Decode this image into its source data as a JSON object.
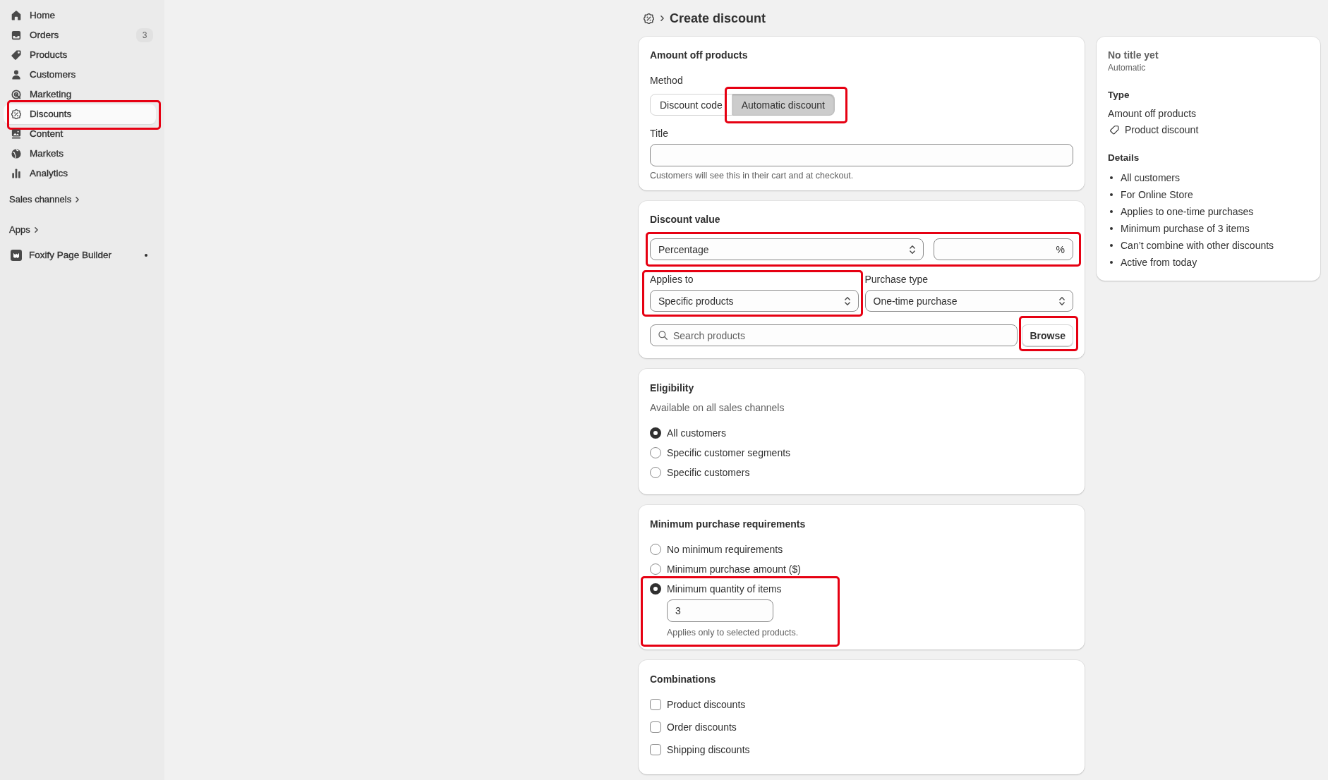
{
  "sidebar": {
    "items": [
      {
        "label": "Home",
        "selected": false,
        "highlighted": false
      },
      {
        "label": "Orders",
        "badge": "3",
        "selected": false,
        "highlighted": false
      },
      {
        "label": "Products",
        "selected": false,
        "highlighted": false
      },
      {
        "label": "Customers",
        "selected": false,
        "highlighted": false
      },
      {
        "label": "Marketing",
        "selected": false,
        "highlighted": false
      },
      {
        "label": "Discounts",
        "selected": true,
        "highlighted": true
      },
      {
        "label": "Content",
        "selected": false,
        "highlighted": false
      },
      {
        "label": "Markets",
        "selected": false,
        "highlighted": false
      },
      {
        "label": "Analytics",
        "selected": false,
        "highlighted": false
      }
    ],
    "sections": [
      {
        "label": "Sales channels"
      },
      {
        "label": "Apps",
        "apps": [
          {
            "label": "Foxify Page Builder"
          }
        ]
      }
    ]
  },
  "header": {
    "title": "Create discount"
  },
  "method_card": {
    "title": "Amount off products",
    "method": {
      "label": "Method",
      "options": [
        {
          "label": "Discount code",
          "selected": false,
          "highlighted": false
        },
        {
          "label": "Automatic discount",
          "selected": true,
          "highlighted": true
        }
      ]
    },
    "title_field": {
      "label": "Title",
      "help": "Customers will see this in their cart and at checkout."
    }
  },
  "value_card": {
    "title": "Discount value",
    "discount": {
      "type": "Percentage",
      "suffix": "%",
      "highlighted": true
    },
    "applies_to": {
      "label": "Applies to",
      "value": "Specific products",
      "highlighted": true
    },
    "purchase_type": {
      "label": "Purchase type",
      "value": "One-time purchase"
    },
    "search": {
      "placeholder": "Search products"
    },
    "browse_button": {
      "label": "Browse",
      "highlighted": true
    }
  },
  "eligibility_card": {
    "title": "Eligibility",
    "subtitle": "Available on all sales channels",
    "options": [
      {
        "label": "All customers",
        "selected": true
      },
      {
        "label": "Specific customer segments",
        "selected": false
      },
      {
        "label": "Specific customers",
        "selected": false
      }
    ]
  },
  "minimum_card": {
    "title": "Minimum purchase requirements",
    "options": [
      {
        "label": "No minimum requirements",
        "selected": false,
        "highlighted": false
      },
      {
        "label": "Minimum purchase amount ($)",
        "selected": false,
        "highlighted": false
      },
      {
        "label": "Minimum quantity of items",
        "selected": true,
        "highlighted": true,
        "value": "3",
        "help": "Applies only to selected products."
      }
    ]
  },
  "combinations_card": {
    "title": "Combinations",
    "options": [
      {
        "label": "Product discounts",
        "checked": false
      },
      {
        "label": "Order discounts",
        "checked": false
      },
      {
        "label": "Shipping discounts",
        "checked": false
      }
    ]
  },
  "summary": {
    "title": "No title yet",
    "method": "Automatic",
    "type": {
      "heading": "Type",
      "name": "Amount off products",
      "category": "Product discount"
    },
    "details": {
      "heading": "Details",
      "items": [
        "All customers",
        "For Online Store",
        "Applies to one-time purchases",
        "Minimum purchase of 3 items",
        "Can’t combine with other discounts",
        "Active from today"
      ]
    }
  }
}
